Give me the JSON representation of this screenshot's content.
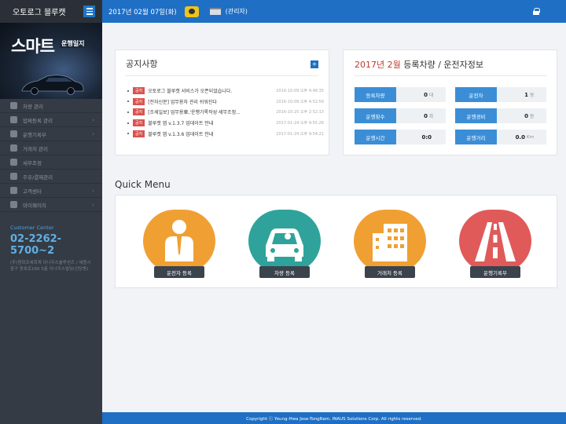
{
  "sidebar": {
    "brand_title": "오토로그 블루캣",
    "banner_main": "스마트",
    "banner_sub": "운행일지",
    "items": [
      {
        "label": "차량 관리",
        "chev": ""
      },
      {
        "label": "업체등록 관리",
        "chev": "›"
      },
      {
        "label": "운행기록부",
        "chev": "›"
      },
      {
        "label": "거래처 관리",
        "chev": ""
      },
      {
        "label": "세무조정",
        "chev": ""
      },
      {
        "label": "주유/결제관리",
        "chev": ""
      },
      {
        "label": "고객센터",
        "chev": "›"
      },
      {
        "label": "마이페이지",
        "chev": "›"
      }
    ],
    "support_title": "Customer Center",
    "support_phone": "02-2262-5700~2",
    "support_info": "(주)원화조세회계 이나우스솔루션즈 / 세종시 중구 동호로166 5층 이나우스빌딩(신당동)"
  },
  "topbar": {
    "date": "2017년 02월 07일(화)",
    "role": "(관리자)"
  },
  "notice": {
    "title": "공지사항",
    "add_icon": "+",
    "items": [
      {
        "badge": "공지",
        "text": "오토로그 블루캣 서비스가 오픈되었습니다.",
        "date": "2016-10-09 오후 4:48:35"
      },
      {
        "badge": "공지",
        "text": "[전자신문] 업무용차 관리 쉬워진다",
        "date": "2016-10-09 오후 4:52:59"
      },
      {
        "badge": "공지",
        "text": "[조세일보] 업무용車,'운행기록작성·세무조정...",
        "date": "2016-10-25 오후 2:52:13"
      },
      {
        "badge": "공지",
        "text": "블루캣 앱 v.1.3.7 업데이트 안내",
        "date": "2017-01-24 오후 9:55:26"
      },
      {
        "badge": "공지",
        "text": "블루캣 앱 v.1.3.6 업데이트 안내",
        "date": "2017-01-24 오후 9:54:21"
      }
    ]
  },
  "stats": {
    "title_month": "2017년 2월",
    "title_rest": " 등록차량 / 운전자정보",
    "items": [
      {
        "label": "등록차량",
        "value": "0",
        "unit": "대"
      },
      {
        "label": "운전자",
        "value": "1",
        "unit": "명"
      },
      {
        "label": "운행횟수",
        "value": "0",
        "unit": "회"
      },
      {
        "label": "운행경비",
        "value": "0",
        "unit": "원"
      },
      {
        "label": "운행시간",
        "value": "0:0",
        "unit": ""
      },
      {
        "label": "운행거리",
        "value": "0.0",
        "unit": "Km"
      }
    ]
  },
  "quick": {
    "title": "Quick Menu",
    "items": [
      {
        "label": "운전자 등록",
        "color": "#f0a032"
      },
      {
        "label": "차량 등록",
        "color": "#2fa39b"
      },
      {
        "label": "거래처 등록",
        "color": "#f0a032"
      },
      {
        "label": "운행기록부",
        "color": "#e05a5a"
      }
    ]
  },
  "footer": {
    "text": "Copyright ⓒ Young-Hwa Jose-TongRam, INAUS Solutions Corp. All rights reserved."
  }
}
